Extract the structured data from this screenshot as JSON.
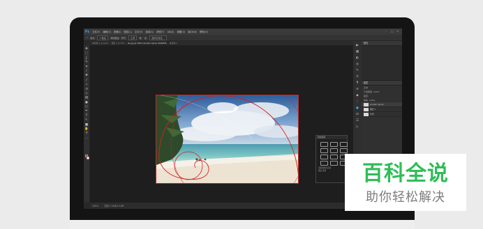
{
  "app": {
    "logo": "Ps",
    "menus": [
      "文件(F)",
      "编辑(E)",
      "图像(I)",
      "图层(L)",
      "文字(Y)",
      "选择(S)",
      "滤镜(T)",
      "3D(D)",
      "视图(V)",
      "窗口(W)",
      "帮助(H)"
    ]
  },
  "options_bar": {
    "items": [
      "羽化:",
      "0 像素",
      "消除锯齿",
      "样式:",
      "正常",
      "宽:",
      "高:",
      "选择并遮住..."
    ]
  },
  "document_tabs": [
    {
      "label": "未标题-1 @ 100%",
      "active": false
    },
    {
      "label": "图层 1 @ 50%",
      "active": false
    },
    {
      "label": "ab.jpg @ 100% (Golden Spiral, RGB/8#)",
      "active": true
    },
    {
      "label": "未标题-2",
      "active": false
    }
  ],
  "tools": [
    "move-icon",
    "marquee-icon",
    "lasso-icon",
    "quick-select-icon",
    "crop-icon",
    "eyedropper-icon",
    "healing-icon",
    "brush-icon",
    "stamp-icon",
    "history-brush-icon",
    "eraser-icon",
    "gradient-icon",
    "blur-icon",
    "dodge-icon",
    "pen-icon",
    "type-icon",
    "path-select-icon",
    "rectangle-icon",
    "hand-icon",
    "zoom-icon",
    "more-icon"
  ],
  "colors": {
    "foreground": "#e0201e",
    "background": "#ffffff",
    "guide": "#d81e1e",
    "accent": "#31a8ff",
    "watermark_green": "#2fbd57"
  },
  "status": {
    "zoom": "100%",
    "doc_size": "文档:1.54M/1.54M"
  },
  "panels": {
    "top_title": "属性",
    "layers_title": "图层",
    "layers_controls": [
      "正常",
      "不透明度: 100%",
      "锁定:",
      "填充: 100%"
    ],
    "layers": [
      {
        "name": "Golden Spiral",
        "selected": true
      },
      {
        "name": "图层 1",
        "selected": false
      },
      {
        "name": "背景",
        "selected": false
      }
    ]
  },
  "overlay_menu": {
    "title": "叠加选项",
    "footer": [
      "选取叠加的选项",
      "确定 取消"
    ]
  },
  "watermark": {
    "title": "百科全说",
    "subtitle": "助你轻松解决"
  }
}
